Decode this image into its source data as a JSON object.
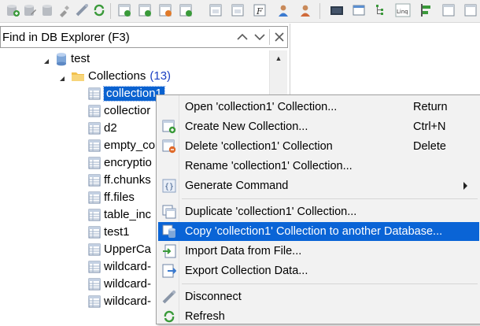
{
  "toolbar": {
    "icons": [
      "add-database-icon",
      "edit-database-icon",
      "remove-database-icon",
      "disconnect-icon",
      "connect-icon",
      "refresh-icon",
      "new-collection-icon",
      "import-collection-icon",
      "export-collection-icon",
      "copy-collection-icon",
      "function-icon",
      "user-icon",
      "role-icon",
      "shell-icon",
      "window-icon",
      "tree-view-icon",
      "linq-icon",
      "align-icon",
      "properties-icon",
      "layout-icon"
    ]
  },
  "search": {
    "placeholder": "Find in DB Explorer (F3)"
  },
  "tree": {
    "database": "test",
    "collections_label": "Collections",
    "collections_count": "(13)",
    "items": [
      "collection1",
      "collectior",
      "d2",
      "empty_co",
      "encryptio",
      "ff.chunks",
      "ff.files",
      "table_inc",
      "test1",
      "UpperCa",
      "wildcard-",
      "wildcard-",
      "wildcard-"
    ]
  },
  "menu": {
    "items": [
      {
        "label": "Open 'collection1' Collection...",
        "shortcut": "Return",
        "icon": "none"
      },
      {
        "label": "Create New Collection...",
        "shortcut": "Ctrl+N",
        "icon": "create-collection-icon"
      },
      {
        "label": "Delete 'collection1' Collection",
        "shortcut": "Delete",
        "icon": "delete-collection-icon"
      },
      {
        "label": "Rename 'collection1' Collection...",
        "shortcut": "",
        "icon": "none"
      },
      {
        "label": "Generate Command",
        "shortcut": "",
        "icon": "braces-icon"
      },
      {
        "label": "Duplicate 'collection1' Collection...",
        "shortcut": "",
        "icon": "duplicate-collection-icon"
      },
      {
        "label": "Copy 'collection1' Collection to another Database...",
        "shortcut": "",
        "icon": "copy-database-icon"
      },
      {
        "label": "Import Data from File...",
        "shortcut": "",
        "icon": "import-icon"
      },
      {
        "label": "Export Collection Data...",
        "shortcut": "",
        "icon": "export-icon"
      },
      {
        "label": "Disconnect",
        "shortcut": "",
        "icon": "disconnect-icon"
      },
      {
        "label": "Refresh",
        "shortcut": "",
        "icon": "refresh-icon"
      }
    ]
  },
  "colors": {
    "selection": "#0a62d0",
    "count_text": "#1a3fc2",
    "menu_bg": "#f2f2f2"
  }
}
